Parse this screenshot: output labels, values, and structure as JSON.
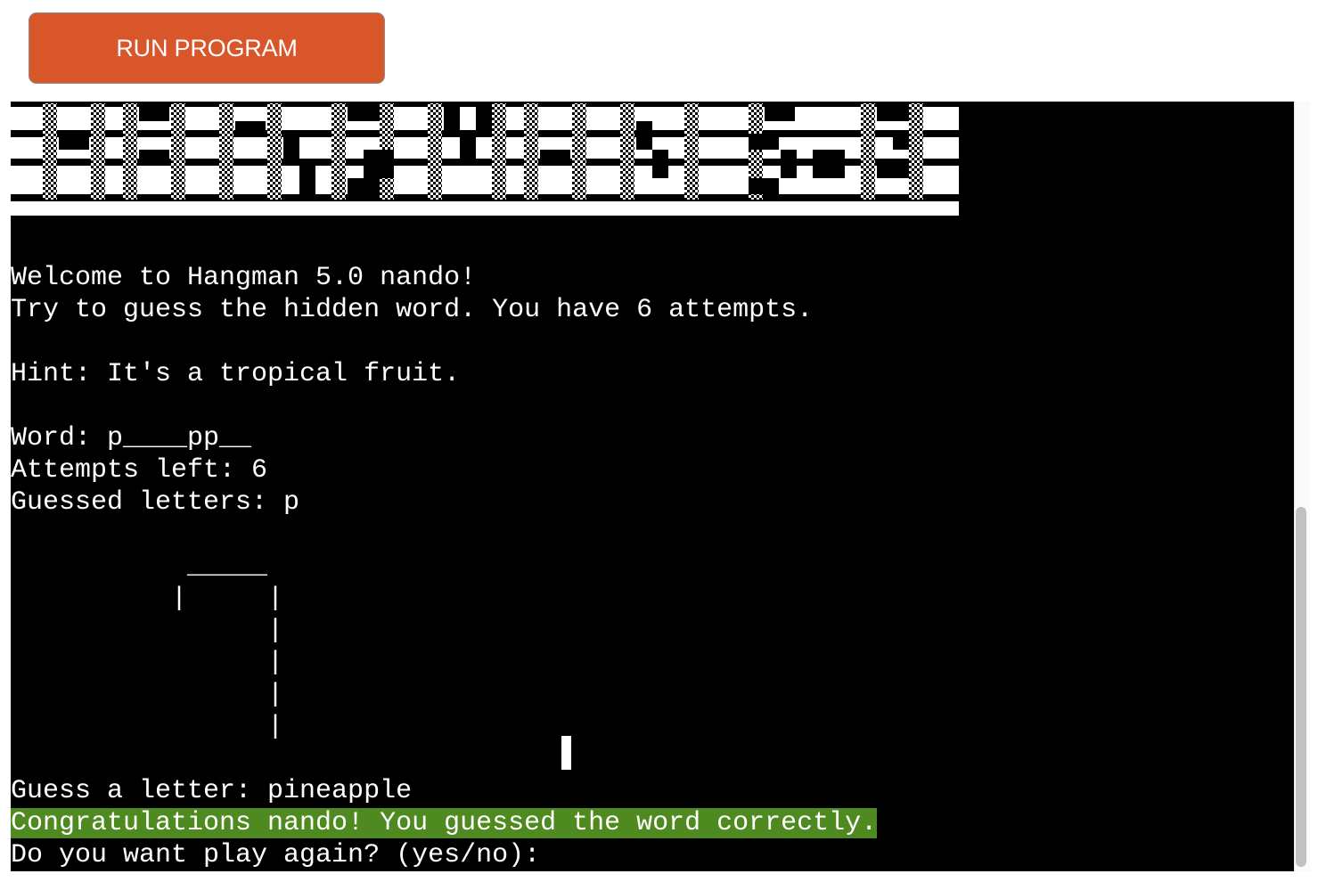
{
  "toolbar": {
    "run_label": "RUN PROGRAM",
    "run_color": "#d9552a"
  },
  "terminal": {
    "banner_label": "HANGMAN 5.0",
    "welcome": "Welcome to Hangman 5.0 nando!",
    "instructions": "Try to guess the hidden word. You have 6 attempts.",
    "hint": "Hint: It's a tropical fruit.",
    "word": "Word: p____pp__",
    "attempts": "Attempts left: 6",
    "guessed": "Guessed letters: p",
    "gallows": {
      "top": "  _____",
      "row1": " |     |",
      "row2": "       |",
      "row3": "       |",
      "row4": "       |",
      "row5": "       |"
    },
    "guess_prompt": "Guess a letter: pineapple",
    "success_message": "Congratulations nando! You guessed the word correctly.",
    "success_color": "#4e8a1f",
    "play_again_prompt": "Do you want play again? (yes/no): "
  }
}
